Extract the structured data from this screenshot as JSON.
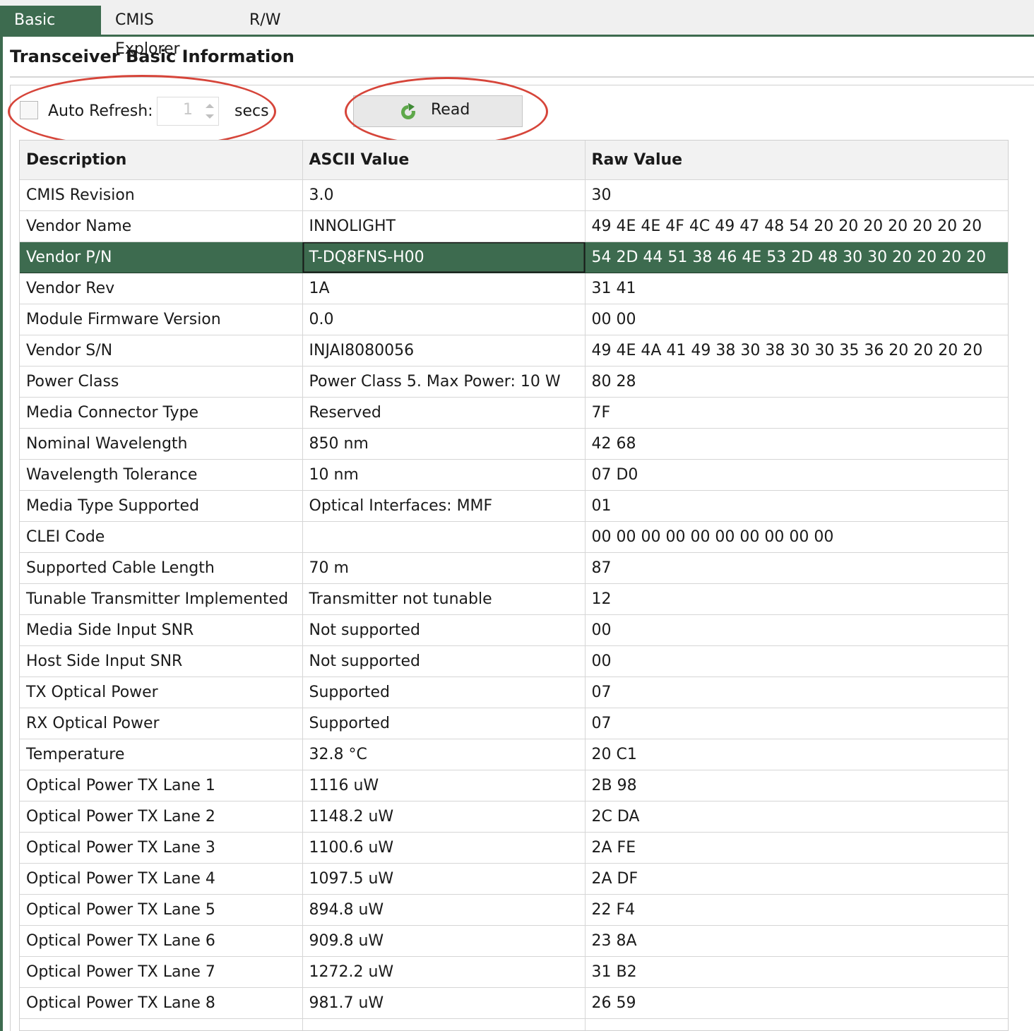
{
  "tabs": [
    {
      "label": "Basic Info",
      "active": true
    },
    {
      "label": "CMIS Explorer",
      "active": false
    },
    {
      "label": "R/W",
      "active": false
    }
  ],
  "page_title": "Transceiver Basic Information",
  "controls": {
    "auto_refresh_label": "Auto Refresh:",
    "auto_refresh_checked": false,
    "interval_value": "1",
    "secs_label": "secs",
    "read_label": "Read"
  },
  "table": {
    "headers": [
      "Description",
      "ASCII Value",
      "Raw Value"
    ],
    "selected_row": 2,
    "rows": [
      [
        "CMIS Revision",
        "3.0",
        "30"
      ],
      [
        "Vendor Name",
        "INNOLIGHT",
        "49 4E 4E 4F 4C 49 47 48 54 20 20 20 20 20 20 20"
      ],
      [
        "Vendor P/N",
        "T-DQ8FNS-H00",
        "54 2D 44 51 38 46 4E 53 2D 48 30 30 20 20 20 20"
      ],
      [
        "Vendor Rev",
        "1A",
        "31 41"
      ],
      [
        "Module Firmware Version",
        "0.0",
        "00 00"
      ],
      [
        "Vendor S/N",
        "INJAI8080056",
        "49 4E 4A 41 49 38 30 38 30 30 35 36 20 20 20 20"
      ],
      [
        "Power Class",
        "Power Class 5. Max Power: 10 W",
        "80 28"
      ],
      [
        "Media Connector Type",
        "Reserved",
        "7F"
      ],
      [
        "Nominal Wavelength",
        "850 nm",
        "42 68"
      ],
      [
        "Wavelength Tolerance",
        "10 nm",
        "07 D0"
      ],
      [
        "Media Type Supported",
        "Optical Interfaces: MMF",
        "01"
      ],
      [
        "CLEI Code",
        "",
        "00 00 00 00 00 00 00 00 00 00"
      ],
      [
        "Supported Cable Length",
        "70 m",
        "87"
      ],
      [
        "Tunable Transmitter Implemented",
        "Transmitter not tunable",
        "12"
      ],
      [
        "Media Side Input SNR",
        "Not supported",
        "00"
      ],
      [
        "Host Side Input SNR",
        "Not supported",
        "00"
      ],
      [
        "TX Optical Power",
        "Supported",
        "07"
      ],
      [
        "RX Optical Power",
        "Supported",
        "07"
      ],
      [
        "Temperature",
        "32.8 °C",
        "20 C1"
      ],
      [
        "Optical Power TX Lane 1",
        "1116 uW",
        "2B 98"
      ],
      [
        "Optical Power TX Lane 2",
        "1148.2 uW",
        "2C DA"
      ],
      [
        "Optical Power TX Lane 3",
        "1100.6 uW",
        "2A FE"
      ],
      [
        "Optical Power TX Lane 4",
        "1097.5 uW",
        "2A DF"
      ],
      [
        "Optical Power TX Lane 5",
        "894.8 uW",
        "22 F4"
      ],
      [
        "Optical Power TX Lane 6",
        "909.8 uW",
        "23 8A"
      ],
      [
        "Optical Power TX Lane 7",
        "1272.2 uW",
        "31 B2"
      ],
      [
        "Optical Power TX Lane 8",
        "981.7 uW",
        "26 59"
      ],
      [
        "",
        "",
        ""
      ]
    ]
  },
  "colors": {
    "accent": "#3d6b4f",
    "annotation": "#d6453a"
  },
  "icons": {
    "read": "refresh-icon"
  }
}
